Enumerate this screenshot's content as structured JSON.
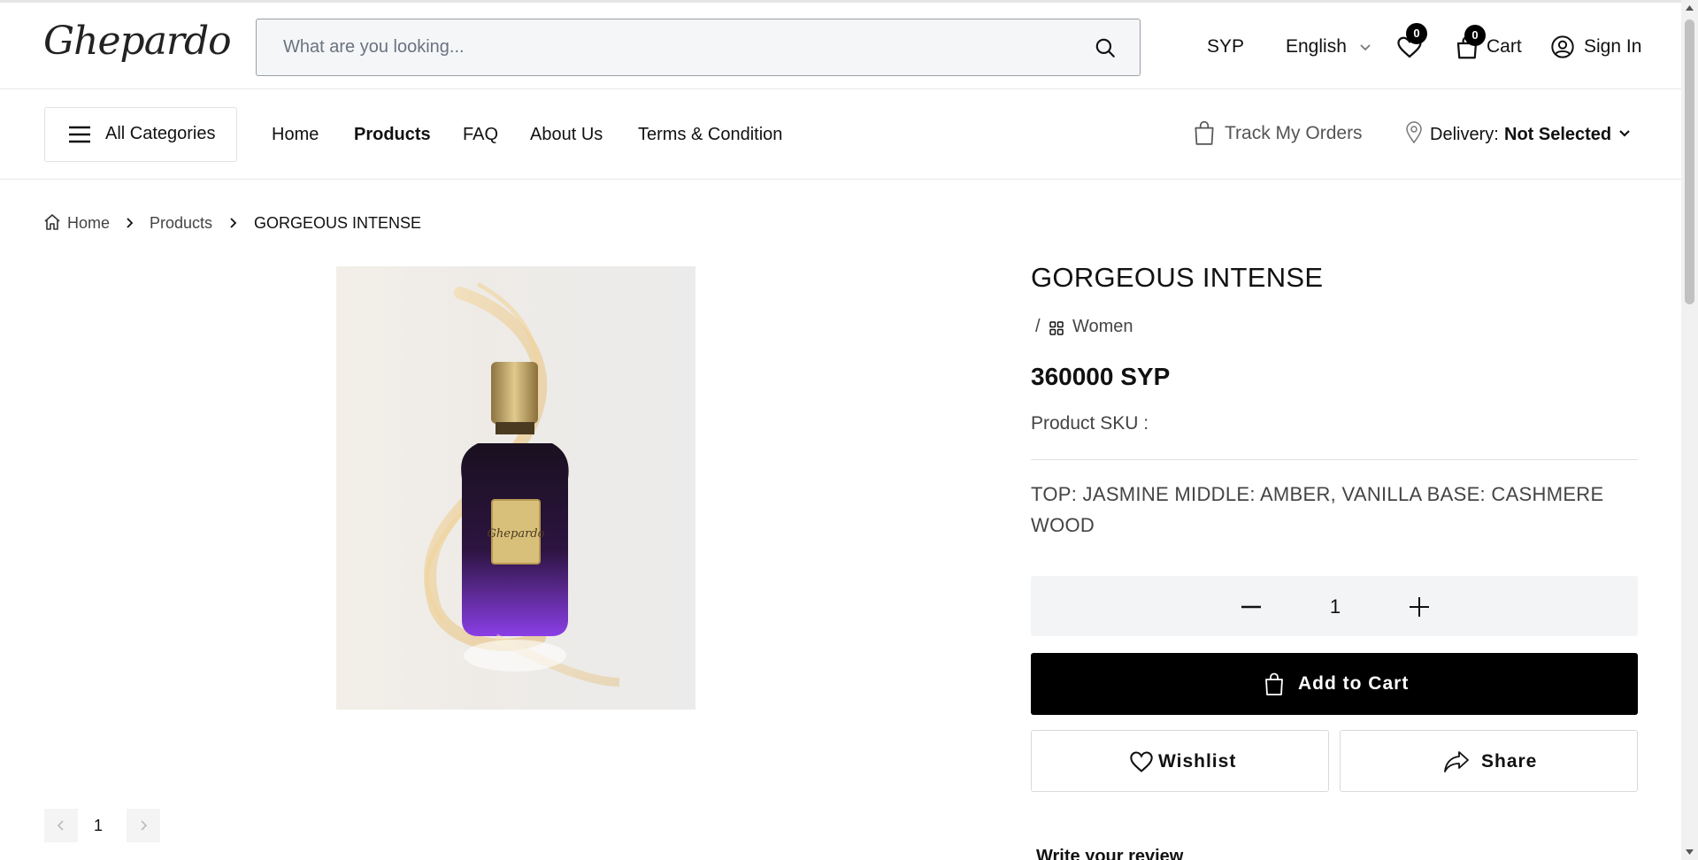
{
  "header": {
    "logo": "Ghepardo",
    "search_placeholder": "What are you looking...",
    "currency": "SYP",
    "language": "English",
    "wishlist_count": "0",
    "cart_count": "0",
    "cart_label": "Cart",
    "signin_label": "Sign In"
  },
  "nav": {
    "all_categories": "All Categories",
    "links": [
      "Home",
      "Products",
      "FAQ",
      "About Us",
      "Terms & Condition"
    ],
    "track_orders": "Track My Orders",
    "delivery_label": "Delivery:",
    "delivery_value": "Not Selected"
  },
  "breadcrumb": [
    "Home",
    "Products",
    "GORGEOUS INTENSE"
  ],
  "gallery": {
    "page": "1",
    "bottle_label": "Ghepardo"
  },
  "product": {
    "title": "GORGEOUS INTENSE",
    "category_slash": "/",
    "category": "Women",
    "price": "360000 SYP",
    "sku_label": "Product SKU :",
    "description": "TOP: JASMINE MIDDLE: AMBER, VANILLA BASE: CASHMERE WOOD",
    "quantity": "1",
    "add_to_cart": "Add to Cart",
    "wishlist": "Wishlist",
    "share": "Share",
    "review_heading": "Write your review"
  },
  "colors": {
    "accent": "#000000",
    "input_bg": "#f4f6f8",
    "bottle_purple": "#7b2fd0"
  }
}
